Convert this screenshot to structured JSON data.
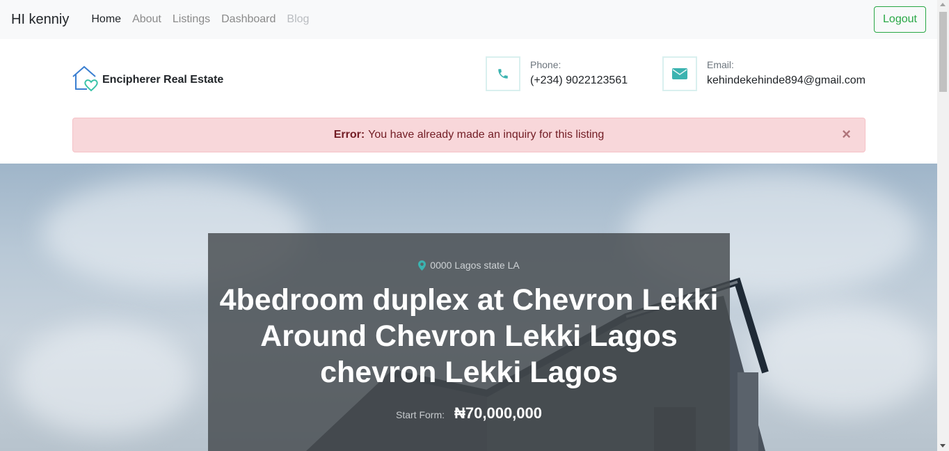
{
  "navbar": {
    "brand": "HI kenniy",
    "links": [
      {
        "label": "Home",
        "state": "active"
      },
      {
        "label": "About",
        "state": "normal"
      },
      {
        "label": "Listings",
        "state": "normal"
      },
      {
        "label": "Dashboard",
        "state": "normal"
      },
      {
        "label": "Blog",
        "state": "disabled"
      }
    ],
    "logout_label": "Logout"
  },
  "header": {
    "logo_icon": "house-heart-icon",
    "site_name": "Encipherer Real Estate",
    "phone": {
      "label": "Phone:",
      "value": "(+234) 9022123561",
      "icon": "phone-icon"
    },
    "email": {
      "label": "Email:",
      "value": "kehindekehinde894@gmail.com",
      "icon": "envelope-icon"
    }
  },
  "alert": {
    "prefix": "Error:",
    "message": "You have already made an inquiry for this listing",
    "close": "×"
  },
  "listing": {
    "location": "0000 Lagos state LA",
    "title": "4bedroom duplex at Chevron Lekki Around Chevron Lekki Lagos chevron Lekki Lagos",
    "price_label": "Start Form:",
    "price": "₦70,000,000"
  },
  "colors": {
    "accent": "#3bb3b0",
    "logout": "#28a745",
    "alert_bg": "#f8d7da",
    "alert_text": "#721c24"
  }
}
